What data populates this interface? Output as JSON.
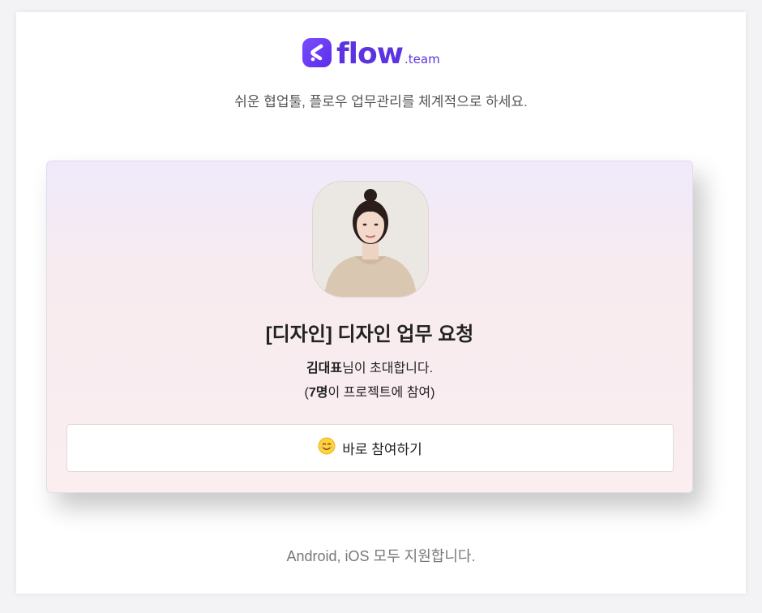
{
  "logo": {
    "mark_icon": "flow-s-logo-icon",
    "word": "flow",
    "sub": ".team",
    "brand_color": "#5b33e0"
  },
  "tagline": "쉬운 협업툴, 플로우 업무관리를 체계적으로 하세요.",
  "card": {
    "title": "[디자인] 디자인 업무 요청",
    "inviter_name": "김대표",
    "inviter_suffix": "님이 초대합니다.",
    "members_open": "(",
    "members_count": "7명",
    "members_suffix": "이 프로젝트에 참여)",
    "join_icon": "smile-emoji-icon",
    "join_label": "바로 참여하기"
  },
  "footer": {
    "note": "Android, iOS 모두 지원합니다."
  }
}
